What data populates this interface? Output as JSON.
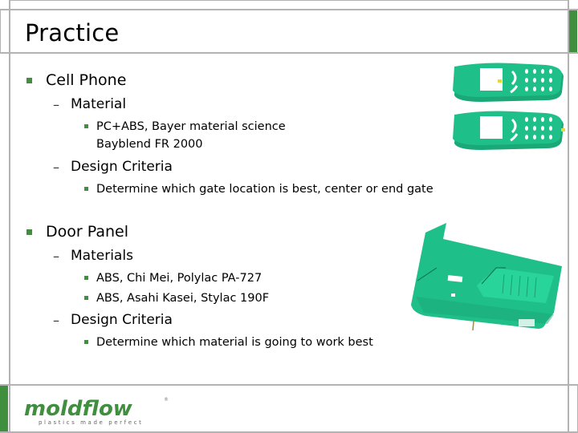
{
  "slide": {
    "title": "Practice",
    "sections": [
      {
        "heading": "Cell Phone",
        "subsections": [
          {
            "heading": "Material",
            "items": [
              "PC+ABS, Bayer material science",
              "Bayblend FR 2000"
            ]
          },
          {
            "heading": "Design Criteria",
            "items": [
              "Determine which gate location is best, center or end gate"
            ]
          }
        ]
      },
      {
        "heading": "Door Panel",
        "subsections": [
          {
            "heading": "Materials",
            "items": [
              "ABS, Chi Mei, Polylac PA-727",
              "ABS, Asahi Kasei, Stylac 190F"
            ]
          },
          {
            "heading": "Design Criteria",
            "items": [
              "Determine which material is going to work best"
            ]
          }
        ]
      }
    ],
    "bullet_marker": "▪",
    "dash_marker": "–"
  },
  "images": {
    "cell_phone": "cell-phone-models-image",
    "door_panel": "door-panel-model-image"
  },
  "logo": {
    "brand": "moldflow",
    "tagline": "plastics made perfect",
    "registered": "®"
  },
  "colors": {
    "accent_green": "#3f8f3f",
    "model_teal": "#1fbf8a",
    "frame_gray": "#b3b3b3"
  }
}
